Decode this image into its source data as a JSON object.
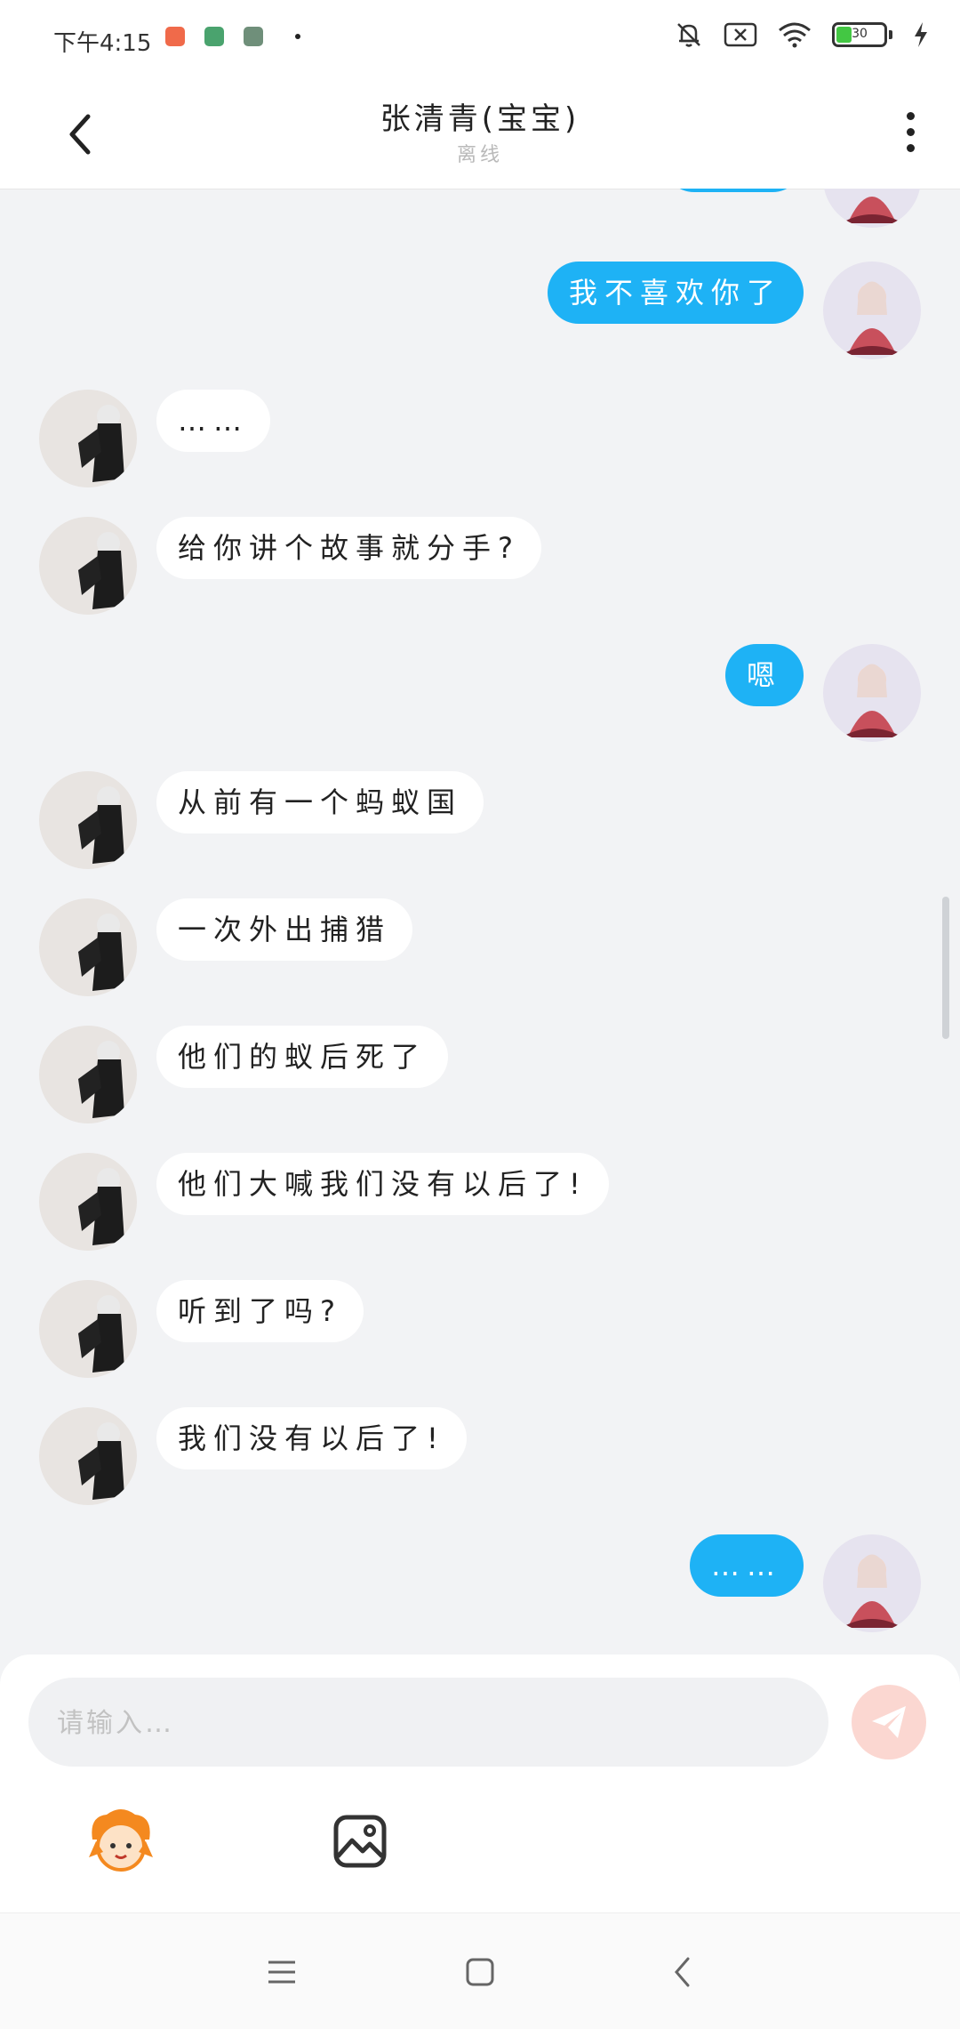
{
  "status_bar": {
    "time": "下午4:15",
    "battery_level": "30",
    "icons": [
      "mute-icon",
      "sim-off-icon",
      "wifi-icon",
      "battery-icon",
      "charging-icon"
    ]
  },
  "header": {
    "title": "张清青(宝宝)",
    "subtitle": "离线"
  },
  "messages": [
    {
      "side": "right",
      "text": "我不喜欢你了"
    },
    {
      "side": "left",
      "text": "……"
    },
    {
      "side": "left",
      "text": "给你讲个故事就分手?"
    },
    {
      "side": "right",
      "text": "嗯"
    },
    {
      "side": "left",
      "text": "从前有一个蚂蚁国"
    },
    {
      "side": "left",
      "text": "一次外出捕猎"
    },
    {
      "side": "left",
      "text": "他们的蚁后死了"
    },
    {
      "side": "left",
      "text": "他们大喊我们没有以后了!"
    },
    {
      "side": "left",
      "text": "听到了吗?"
    },
    {
      "side": "left",
      "text": "我们没有以后了!"
    },
    {
      "side": "right",
      "text": "……"
    }
  ],
  "input": {
    "placeholder": "请输入…",
    "value": ""
  },
  "colors": {
    "accent": "#1eb2f5",
    "send_button": "#fbd7d1",
    "background": "#f2f3f5"
  }
}
